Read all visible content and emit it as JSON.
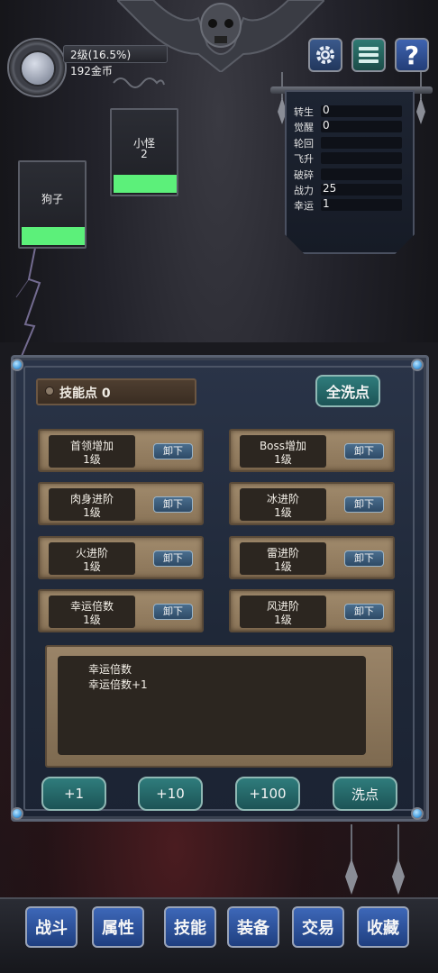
{
  "player": {
    "level_text": "2级(16.5%)",
    "gold_text": "192金币"
  },
  "top_buttons": {
    "gear_icon": "gear-icon",
    "menu_icon": "menu-icon",
    "help_label": "?"
  },
  "stats": [
    {
      "label": "转生",
      "value": "0"
    },
    {
      "label": "觉醒",
      "value": "0"
    },
    {
      "label": "轮回",
      "value": ""
    },
    {
      "label": "飞升",
      "value": ""
    },
    {
      "label": "破碎",
      "value": ""
    },
    {
      "label": "战力",
      "value": "25"
    },
    {
      "label": "幸运",
      "value": "1"
    }
  ],
  "monsters": [
    {
      "name": "狗子",
      "count": "",
      "hp_fraction": 1.0
    },
    {
      "name": "小怪",
      "count": "2",
      "hp_fraction": 1.0
    }
  ],
  "skill_panel": {
    "skill_points_text": "技能点 0",
    "wash_all_label": "全洗点",
    "unequip_label": "卸下",
    "skills": [
      {
        "name": "首领增加",
        "level": "1级"
      },
      {
        "name": "Boss增加",
        "level": "1级"
      },
      {
        "name": "肉身进阶",
        "level": "1级"
      },
      {
        "name": "冰进阶",
        "level": "1级"
      },
      {
        "name": "火进阶",
        "level": "1级"
      },
      {
        "name": "雷进阶",
        "level": "1级"
      },
      {
        "name": "幸运倍数",
        "level": "1级"
      },
      {
        "name": "风进阶",
        "level": "1级"
      }
    ],
    "description": {
      "title": "幸运倍数",
      "effect": "幸运倍数+1"
    },
    "action_buttons": [
      "+1",
      "+10",
      "+100",
      "洗点"
    ]
  },
  "nav": [
    "战斗",
    "属性",
    "技能",
    "装备",
    "交易",
    "收藏"
  ],
  "colors": {
    "hp_green": "#5cf07a",
    "button_teal": "#2f7c7c",
    "nav_blue": "#3d67b8"
  }
}
